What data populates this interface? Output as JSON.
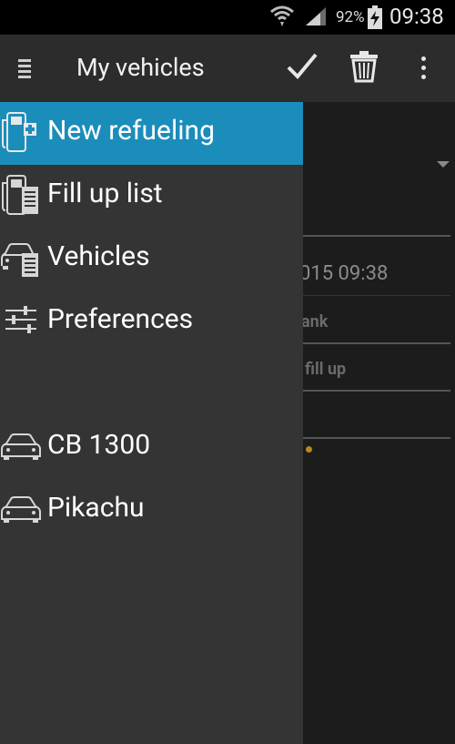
{
  "status_bar": {
    "battery_percent": "92%",
    "time": "09:38"
  },
  "action_bar": {
    "title": "My vehicles",
    "icons": [
      "drawer-toggle-icon",
      "check-icon",
      "trash-icon",
      "overflow-menu-icon"
    ]
  },
  "drawer": {
    "items": [
      {
        "label": "New refueling",
        "icon": "fuel-pump-plus-icon",
        "active": true
      },
      {
        "label": "Fill up list",
        "icon": "fuel-pump-list-icon",
        "active": false
      },
      {
        "label": "Vehicles",
        "icon": "car-list-icon",
        "active": false
      },
      {
        "label": "Preferences",
        "icon": "sliders-icon",
        "active": false
      }
    ],
    "vehicles": [
      {
        "label": "CB 1300",
        "icon": "car-icon"
      },
      {
        "label": "Pikachu",
        "icon": "car-icon"
      }
    ]
  },
  "background": {
    "date_fragment": "015 09:38",
    "tank_fragment": "ank",
    "fillup_fragment": "fill up"
  },
  "colors": {
    "status_bar": "#000000",
    "action_bar": "#2c2c2c",
    "drawer": "#343434",
    "active_item": "#1b8dbb",
    "content_bg": "#1c1c1c"
  }
}
